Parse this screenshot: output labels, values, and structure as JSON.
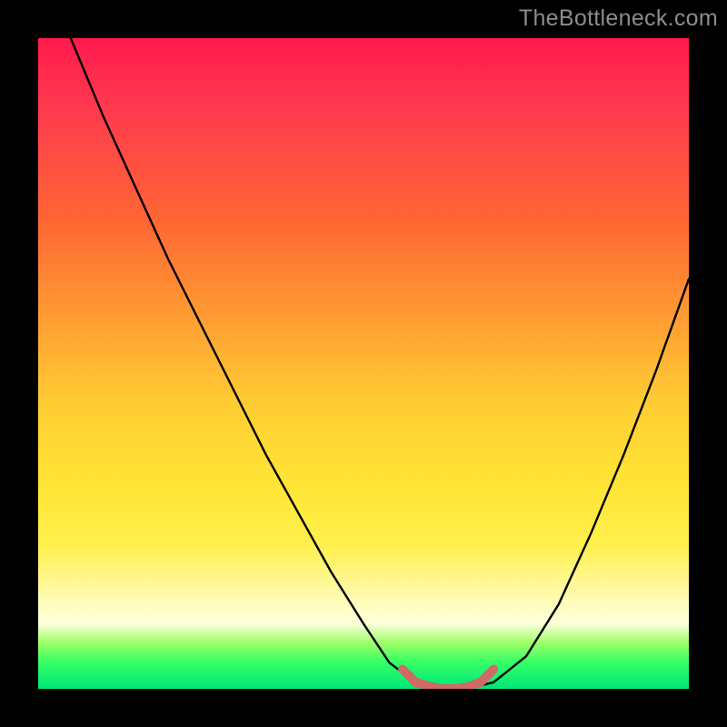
{
  "watermark": "TheBottleneck.com",
  "colors": {
    "frame_bg": "#000000",
    "gradient_top": "#ff1a4d",
    "gradient_mid": "#ffe433",
    "gradient_bottom": "#00e676",
    "curve": "#000000",
    "base_line": "#d06060"
  },
  "chart_data": {
    "type": "line",
    "title": "",
    "xlabel": "",
    "ylabel": "",
    "xlim": [
      0,
      100
    ],
    "ylim": [
      0,
      100
    ],
    "series": [
      {
        "name": "bottleneck-curve",
        "x": [
          5,
          10,
          15,
          20,
          25,
          30,
          35,
          40,
          45,
          50,
          54,
          58,
          62,
          66,
          70,
          75,
          80,
          85,
          90,
          95,
          100
        ],
        "values": [
          100,
          88,
          77,
          66,
          56,
          46,
          36,
          27,
          18,
          10,
          4,
          1,
          0,
          0,
          1,
          5,
          13,
          24,
          36,
          49,
          63
        ]
      },
      {
        "name": "valley-floor",
        "x": [
          56,
          58,
          60,
          62,
          64,
          66,
          68,
          70
        ],
        "values": [
          3,
          1,
          0.4,
          0,
          0,
          0.3,
          1,
          3
        ]
      }
    ],
    "notes": "No visible axis ticks or numeric labels; values estimated from curve shape. Origin at bottom-left."
  }
}
